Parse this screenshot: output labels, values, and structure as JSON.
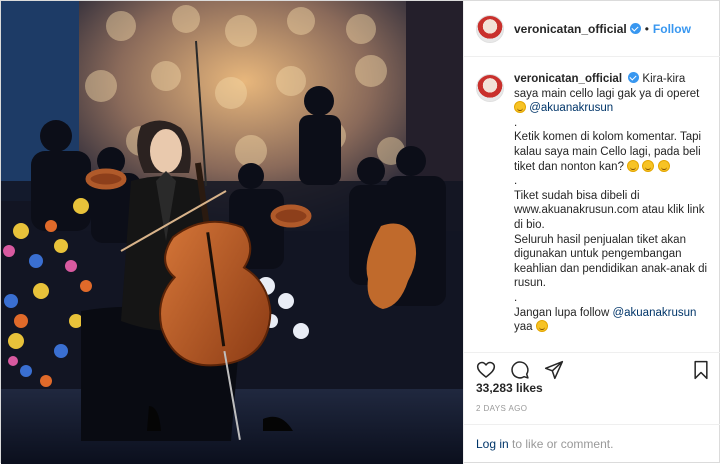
{
  "header": {
    "username": "veronicatan_official",
    "separator": "•",
    "follow_label": "Follow"
  },
  "caption": {
    "username": "veronicatan_official",
    "line1": "Kira-kira saya main cello lagi gak ya di operet",
    "mention1": "@akuanakrusun",
    "line2": "Ketik komen di kolom komentar. Tapi kalau saya main Cello lagi, pada beli tiket dan nonton kan?",
    "line3": "Tiket sudah bisa dibeli di www.akuanakrusun.com atau klik link di bio.",
    "line4": "Seluruh hasil penjualan tiket akan digunakan untuk pengembangan keahlian dan pendidikan anak-anak di rusun.",
    "line5": "Jangan lupa follow",
    "mention2": "@akuanakrusun",
    "line5_end": "yaa",
    "dot": "."
  },
  "stats": {
    "likes": "33,283 likes",
    "posted": "2 DAYS AGO"
  },
  "footer": {
    "login_label": "Log in",
    "login_suffix": " to like or comment."
  },
  "icons": {
    "like": "heart-icon",
    "comment": "comment-icon",
    "share": "share-icon",
    "save": "bookmark-icon",
    "verified": "verified-badge-icon"
  },
  "colors": {
    "link": "#3897f0",
    "mention": "#003569",
    "muted": "#999999"
  }
}
